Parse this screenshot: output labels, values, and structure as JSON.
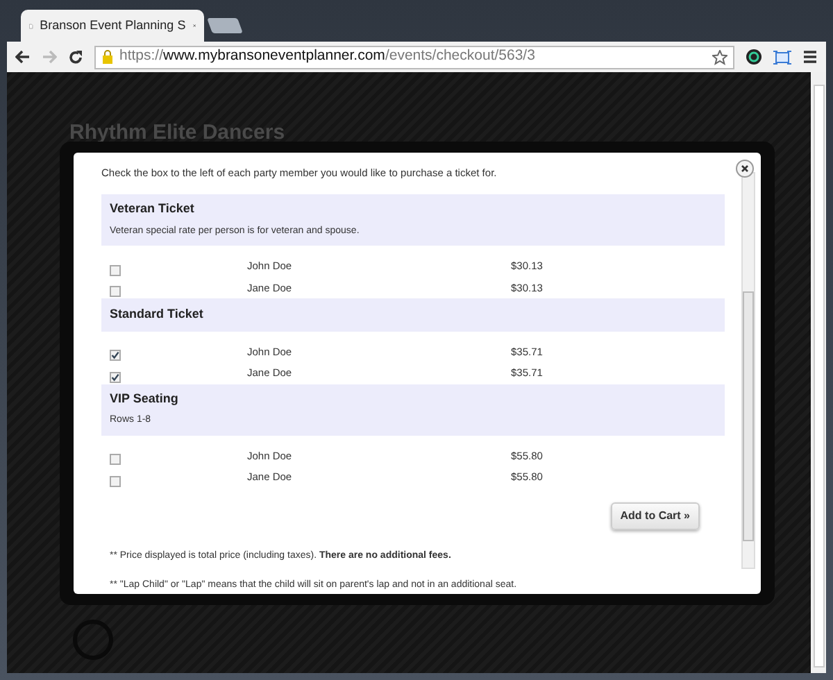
{
  "browser": {
    "tab_title": "Branson Event Planning S",
    "url_scheme": "https://",
    "url_host": "www.mybransoneventplanner.com",
    "url_path": "/events/checkout/563/3"
  },
  "page": {
    "heading": "Rhythm Elite Dancers"
  },
  "modal": {
    "instruction": "Check the box to the left of each party member you would like to purchase a ticket for.",
    "groups": [
      {
        "name": "Veteran Ticket",
        "note": "Veteran special rate per person is for veteran and spouse.",
        "members": [
          {
            "name": "John Doe",
            "price": "$30.13",
            "checked": false
          },
          {
            "name": "Jane Doe",
            "price": "$30.13",
            "checked": false
          }
        ]
      },
      {
        "name": "Standard Ticket",
        "members": [
          {
            "name": "John Doe",
            "price": "$35.71",
            "checked": true
          },
          {
            "name": "Jane Doe",
            "price": "$35.71",
            "checked": true
          }
        ]
      },
      {
        "name": "VIP Seating",
        "note": "Rows 1-8",
        "members": [
          {
            "name": "John Doe",
            "price": "$55.80",
            "checked": false
          },
          {
            "name": "Jane Doe",
            "price": "$55.80",
            "checked": false
          }
        ]
      }
    ],
    "button": "Add to Cart »",
    "notes": [
      "** Price displayed is total price (including taxes). **There are no additional fees.**",
      "** \"Lap Child\" or \"Lap\" means that the child will sit on parent's lap and not in an additional seat."
    ]
  }
}
